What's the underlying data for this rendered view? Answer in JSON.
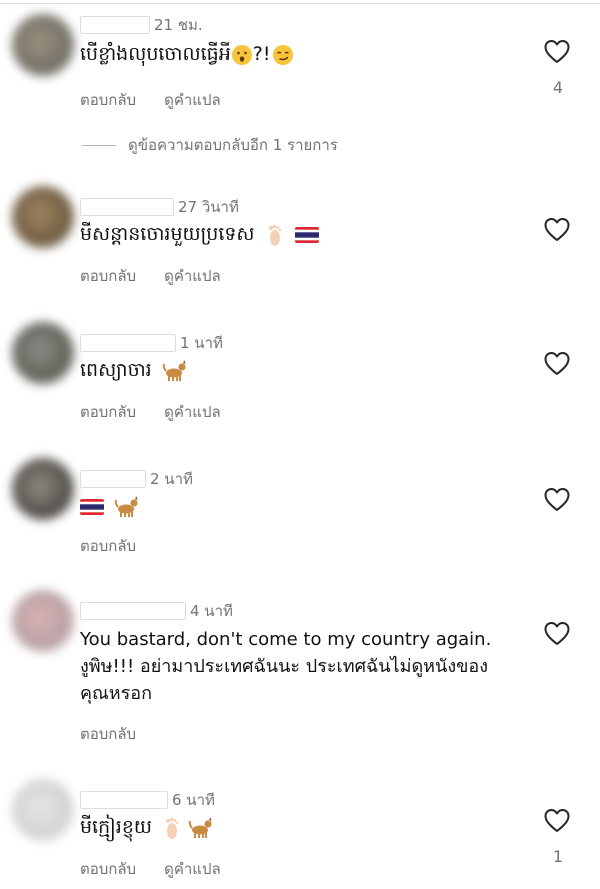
{
  "labels": {
    "reply": "ตอบกลับ",
    "see_translation": "ดูคำแปล"
  },
  "view_more_replies": "ดูข้อความตอบกลับอีก 1 รายการ",
  "comments": [
    {
      "time": "21 ชม.",
      "text": "បើខ្លាំងលុបចោលធ្វើអី",
      "text_suffix": "?!",
      "likes": "4",
      "emojis": [
        "hushed-face",
        "smirking-face"
      ]
    },
    {
      "time": "27 วินาที",
      "text": "មីសន្តានចោរមួយប្រទេស",
      "emojis": [
        "foot",
        "thai-flag"
      ]
    },
    {
      "time": "1 นาที",
      "text": "ពេស្យាចារ",
      "emojis": [
        "dog"
      ]
    },
    {
      "time": "2 นาที",
      "text": "",
      "emojis": [
        "thai-flag",
        "dog"
      ]
    },
    {
      "time": "4 นาที",
      "text": "You bastard, don't come to my country again. งูพิษ!!! อย่ามาประเทศฉันนะ ประเทศฉันไม่ดูหนังของคุณหรอก",
      "emojis": []
    },
    {
      "time": "6 นาที",
      "text": "មីក្មៀរខ្ញុយ",
      "likes": "1",
      "emojis": [
        "foot",
        "dog"
      ]
    }
  ],
  "colors": {
    "text": "#111111",
    "secondary": "#737373",
    "flag_red": "#e0262e",
    "flag_blue": "#2d2a6e"
  }
}
